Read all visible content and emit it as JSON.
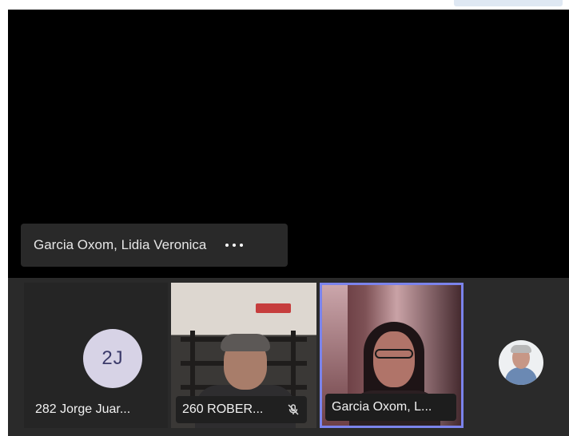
{
  "meeting": {
    "active_speaker": {
      "name": "Garcia Oxom, Lidia Veronica"
    },
    "participants": [
      {
        "initials": "2J",
        "name": "282 Jorge Juar..."
      },
      {
        "name": "260 ROBER...",
        "mic_status": "muted"
      },
      {
        "name": "Garcia Oxom, L...",
        "highlighted": true
      },
      {
        "avatar": "profile-photo"
      }
    ]
  },
  "icons": {
    "more_options": "more-horizontal-icon",
    "muted_mic": "microphone-off-icon"
  },
  "colors": {
    "stage_background": "#000000",
    "strip_background": "#2a2a2a",
    "active_tile_border": "#7b83eb",
    "initials_avatar_bg": "#d7d3e6"
  }
}
